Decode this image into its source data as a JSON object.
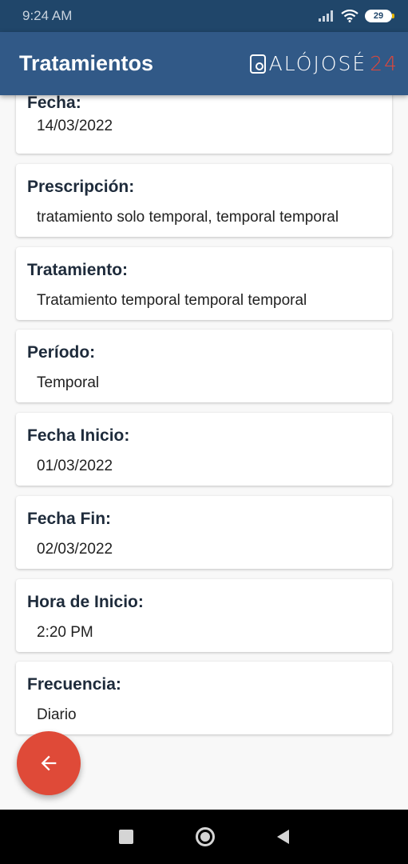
{
  "status_bar": {
    "time": "9:24 AM",
    "battery": "29"
  },
  "app_bar": {
    "title": "Tratamientos",
    "brand_main": "ALÓJOSÉ",
    "brand_accent": "24"
  },
  "fields": [
    {
      "label": "Fecha:",
      "value": "14/03/2022"
    },
    {
      "label": "Prescripción:",
      "value": "tratamiento solo temporal, temporal temporal"
    },
    {
      "label": "Tratamiento:",
      "value": "Tratamiento temporal temporal temporal"
    },
    {
      "label": "Período:",
      "value": "Temporal"
    },
    {
      "label": "Fecha Inicio:",
      "value": "01/03/2022"
    },
    {
      "label": "Fecha Fin:",
      "value": "02/03/2022"
    },
    {
      "label": "Hora de Inicio:",
      "value": "2:20 PM"
    },
    {
      "label": "Frecuencia:",
      "value": "Diario"
    }
  ],
  "fab": {
    "icon": "arrow-left-icon"
  },
  "colors": {
    "app_bar": "#315987",
    "status_bar": "#20466a",
    "fab": "#df4a38",
    "brand_accent": "#e0473a"
  }
}
